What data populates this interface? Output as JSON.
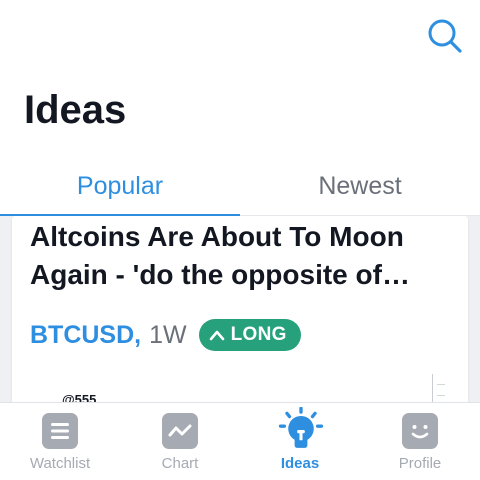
{
  "header": {
    "title": "Ideas",
    "search_icon": "search-icon"
  },
  "tabs": [
    {
      "label": "Popular",
      "active": true
    },
    {
      "label": "Newest",
      "active": false
    }
  ],
  "idea": {
    "title_line1": "Altcoins Are About To Moon",
    "title_line2": "Again - 'do the opposite of…",
    "symbol": "BTCUSD",
    "separator": ",",
    "interval": "1W",
    "direction": "LONG",
    "direction_icon": "chevron-up-icon",
    "thumbnail_text": "@555"
  },
  "bottom_nav": [
    {
      "label": "Watchlist",
      "icon": "watchlist-icon",
      "active": false
    },
    {
      "label": "Chart",
      "icon": "chart-icon",
      "active": false
    },
    {
      "label": "Ideas",
      "icon": "lightbulb-icon",
      "active": true
    },
    {
      "label": "Profile",
      "icon": "profile-icon",
      "active": false
    }
  ],
  "colors": {
    "accent": "#2e8fe0",
    "long_badge": "#27a17c",
    "inactive_icon": "#a6aab2",
    "title_text": "#131722"
  }
}
